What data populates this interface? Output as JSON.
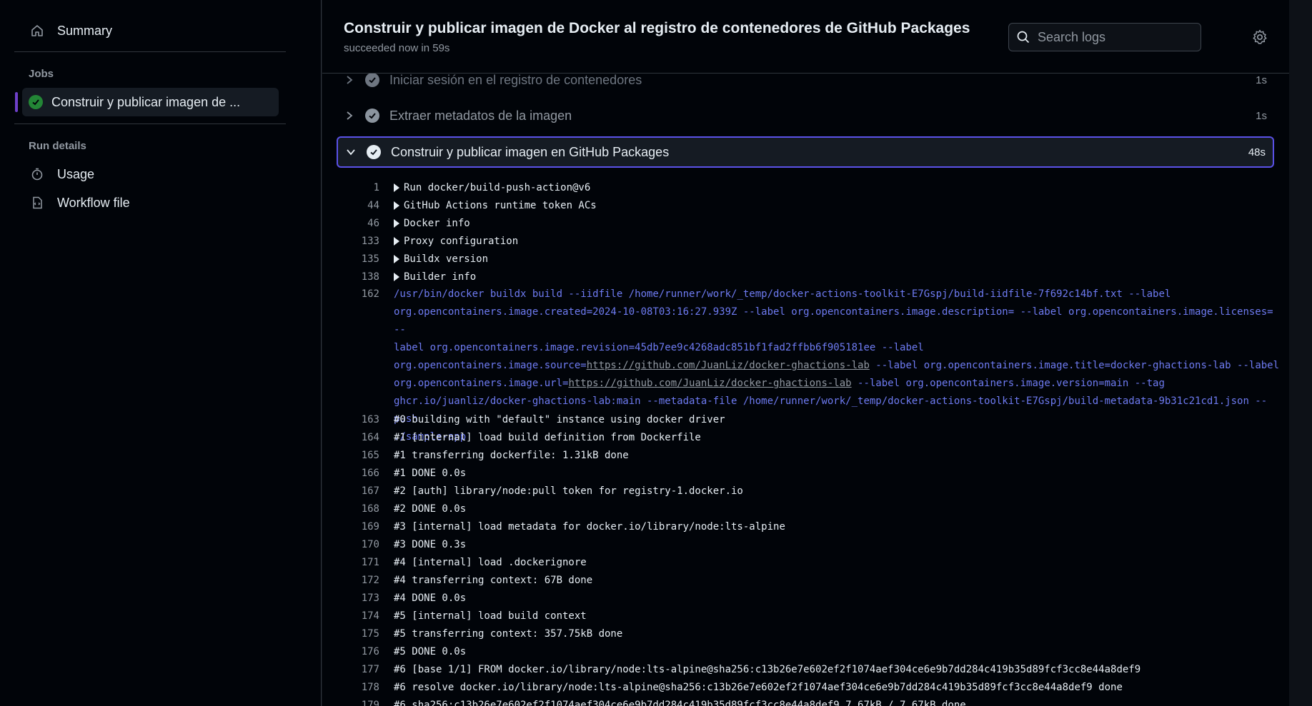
{
  "sidebar": {
    "summary_label": "Summary",
    "jobs_heading": "Jobs",
    "job_label": "Construir y publicar imagen de ...",
    "run_details_heading": "Run details",
    "usage_label": "Usage",
    "workflow_label": "Workflow file"
  },
  "header": {
    "title": "Construir y publicar imagen de Docker al registro de contenedores de GitHub Packages",
    "subtitle": "succeeded now in 59s",
    "search_placeholder": "Search logs"
  },
  "steps": [
    {
      "label": "Iniciar sesión en el registro de contenedores",
      "duration": "1s"
    },
    {
      "label": "Extraer metadatos de la imagen",
      "duration": "1s"
    },
    {
      "label": "Construir y publicar imagen en GitHub Packages",
      "duration": "48s"
    }
  ],
  "groups": [
    {
      "num": "1",
      "text": "Run docker/build-push-action@v6"
    },
    {
      "num": "44",
      "text": "GitHub Actions runtime token ACs"
    },
    {
      "num": "46",
      "text": "Docker info"
    },
    {
      "num": "133",
      "text": "Proxy configuration"
    },
    {
      "num": "135",
      "text": "Buildx version"
    },
    {
      "num": "138",
      "text": "Builder info"
    }
  ],
  "cmd": {
    "num": "162",
    "l1": "/usr/bin/docker buildx build --iidfile /home/runner/work/_temp/docker-actions-toolkit-E7Gspj/build-iidfile-7f692c14bf.txt --label",
    "l2": "org.opencontainers.image.created=2024-10-08T03:16:27.939Z --label org.opencontainers.image.description= --label org.opencontainers.image.licenses= --",
    "l3": "label org.opencontainers.image.revision=45db7ee9c4268adc851bf1fad2ffbb6f905181ee --label",
    "l4a": "org.opencontainers.image.source=",
    "link1": "https://github.com/JuanLiz/docker-ghactions-lab",
    "l4b": " --label org.opencontainers.image.title=docker-ghactions-lab --label",
    "l5a": "org.opencontainers.image.url=",
    "link2": "https://github.com/JuanLiz/docker-ghactions-lab",
    "l5b": " --label org.opencontainers.image.version=main --tag",
    "l6": "ghcr.io/juanliz/docker-ghactions-lab:main --metadata-file /home/runner/work/_temp/docker-actions-toolkit-E7Gspj/build-metadata-9b31c21cd1.json --push",
    "l7": "./sample-app"
  },
  "lines": [
    {
      "num": "163",
      "text": "#0 building with \"default\" instance using docker driver"
    },
    {
      "num": "164",
      "text": "#1 [internal] load build definition from Dockerfile"
    },
    {
      "num": "165",
      "text": "#1 transferring dockerfile: 1.31kB done"
    },
    {
      "num": "166",
      "text": "#1 DONE 0.0s"
    },
    {
      "num": "167",
      "text": "#2 [auth] library/node:pull token for registry-1.docker.io"
    },
    {
      "num": "168",
      "text": "#2 DONE 0.0s"
    },
    {
      "num": "169",
      "text": "#3 [internal] load metadata for docker.io/library/node:lts-alpine"
    },
    {
      "num": "170",
      "text": "#3 DONE 0.3s"
    },
    {
      "num": "171",
      "text": "#4 [internal] load .dockerignore"
    },
    {
      "num": "172",
      "text": "#4 transferring context: 67B done"
    },
    {
      "num": "173",
      "text": "#4 DONE 0.0s"
    },
    {
      "num": "174",
      "text": "#5 [internal] load build context"
    },
    {
      "num": "175",
      "text": "#5 transferring context: 357.75kB done"
    },
    {
      "num": "176",
      "text": "#5 DONE 0.0s"
    },
    {
      "num": "177",
      "text": "#6 [base 1/1] FROM docker.io/library/node:lts-alpine@sha256:c13b26e7e602ef2f1074aef304ce6e9b7dd284c419b35d89fcf3cc8e44a8def9"
    },
    {
      "num": "178",
      "text": "#6 resolve docker.io/library/node:lts-alpine@sha256:c13b26e7e602ef2f1074aef304ce6e9b7dd284c419b35d89fcf3cc8e44a8def9 done"
    },
    {
      "num": "179",
      "text": "#6 sha256:c13b26e7e602ef2f1074aef304ce6e9b7dd284c419b35d89fcf3cc8e44a8def9 7.67kB / 7.67kB done"
    }
  ]
}
